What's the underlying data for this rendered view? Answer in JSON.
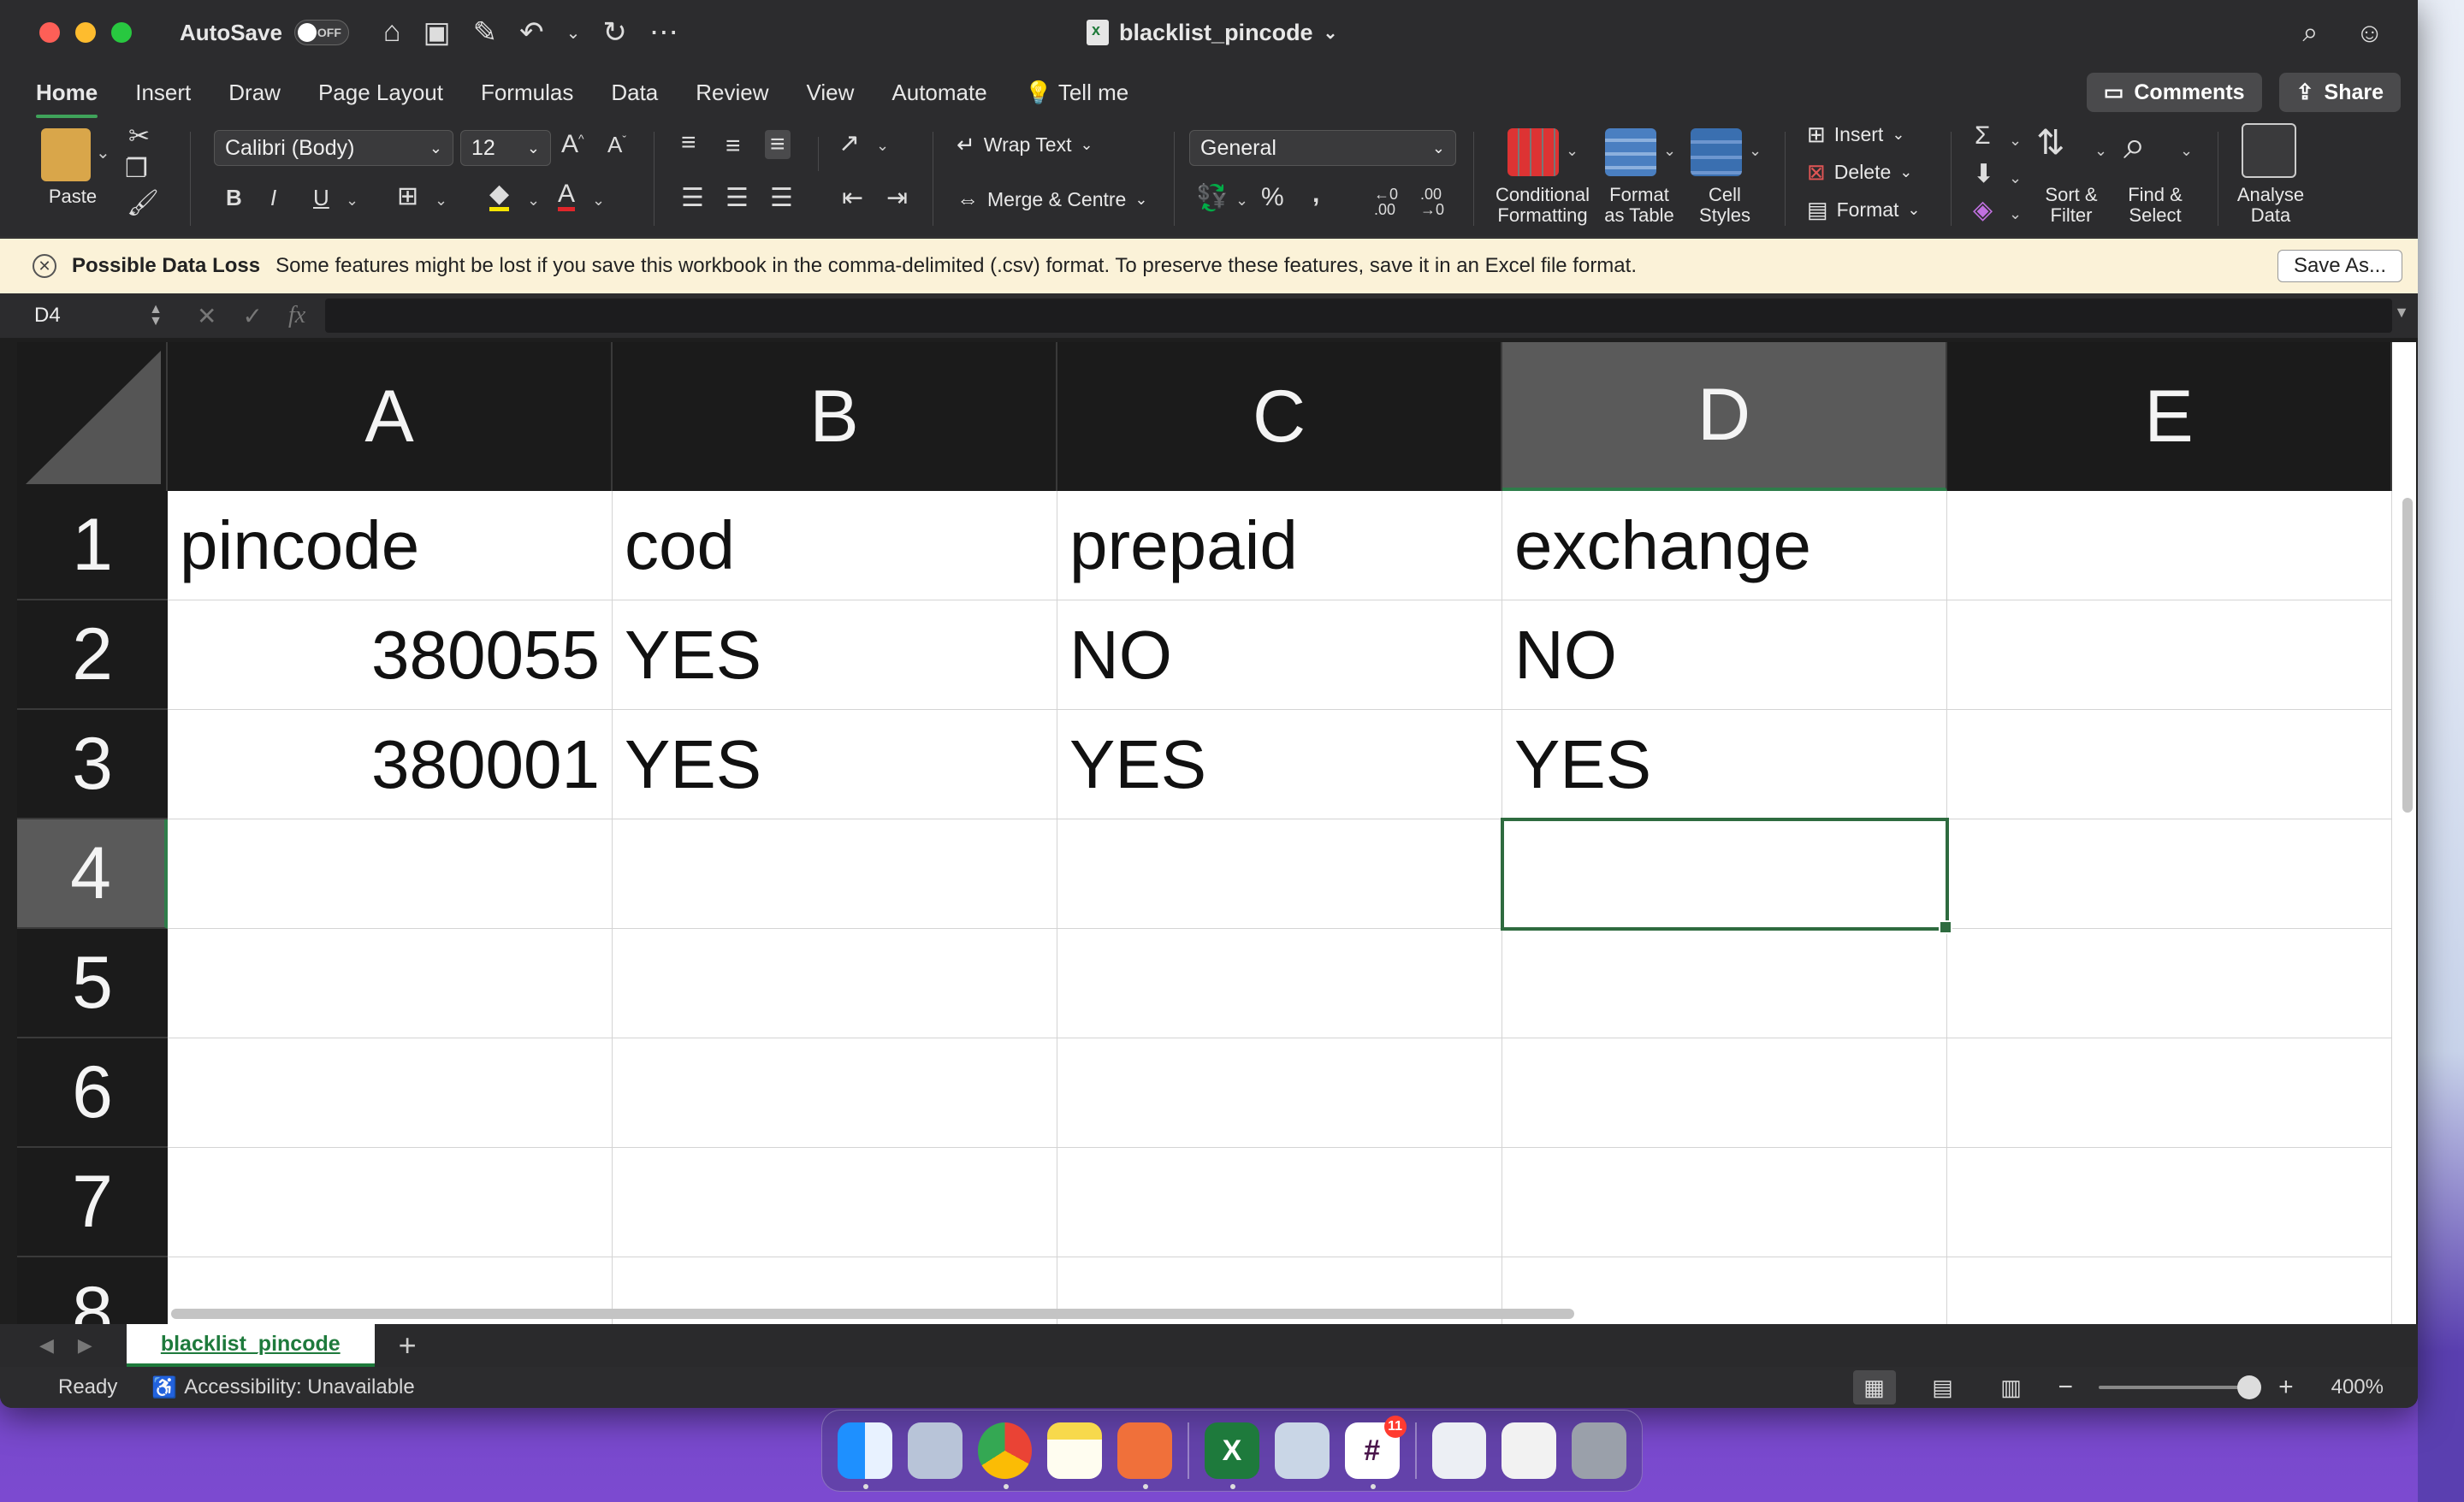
{
  "window": {
    "title": "blacklist_pincode",
    "autosave_label": "AutoSave",
    "autosave_state": "OFF"
  },
  "tabs": [
    "Home",
    "Insert",
    "Draw",
    "Page Layout",
    "Formulas",
    "Data",
    "Review",
    "View",
    "Automate"
  ],
  "tell_me": "Tell me",
  "comments_label": "Comments",
  "share_label": "Share",
  "ribbon": {
    "paste": "Paste",
    "font_name": "Calibri (Body)",
    "font_size": "12",
    "wrap_text": "Wrap Text",
    "merge_centre": "Merge & Centre",
    "number_format": "General",
    "conditional_formatting": [
      "Conditional",
      "Formatting"
    ],
    "format_as_table": [
      "Format",
      "as Table"
    ],
    "cell_styles": [
      "Cell",
      "Styles"
    ],
    "insert": "Insert",
    "delete": "Delete",
    "format": "Format",
    "sort_filter": [
      "Sort &",
      "Filter"
    ],
    "find_select": [
      "Find &",
      "Select"
    ],
    "analyse_data": [
      "Analyse",
      "Data"
    ]
  },
  "message": {
    "title": "Possible Data Loss",
    "text": "Some features might be lost if you save this workbook in the comma-delimited (.csv) format. To preserve these features, save it in an Excel file format.",
    "button": "Save As..."
  },
  "name_box": "D4",
  "columns": [
    "A",
    "B",
    "C",
    "D",
    "E"
  ],
  "rows": [
    "1",
    "2",
    "3",
    "4",
    "5",
    "6",
    "7",
    "8"
  ],
  "cells": {
    "A1": "pincode",
    "B1": "cod",
    "C1": "prepaid",
    "D1": "exchange",
    "A2": "380055",
    "B2": "YES",
    "C2": "NO",
    "D2": "NO",
    "A3": "380001",
    "B3": "YES",
    "C3": "YES",
    "D3": "YES"
  },
  "sheet_tab": "blacklist_pincode",
  "status": {
    "ready": "Ready",
    "accessibility": "Accessibility: Unavailable",
    "zoom": "400%"
  },
  "dock_badge": "11",
  "colors": {
    "accent_green": "#1e7a3c",
    "message_bg": "#fbf2d8"
  }
}
